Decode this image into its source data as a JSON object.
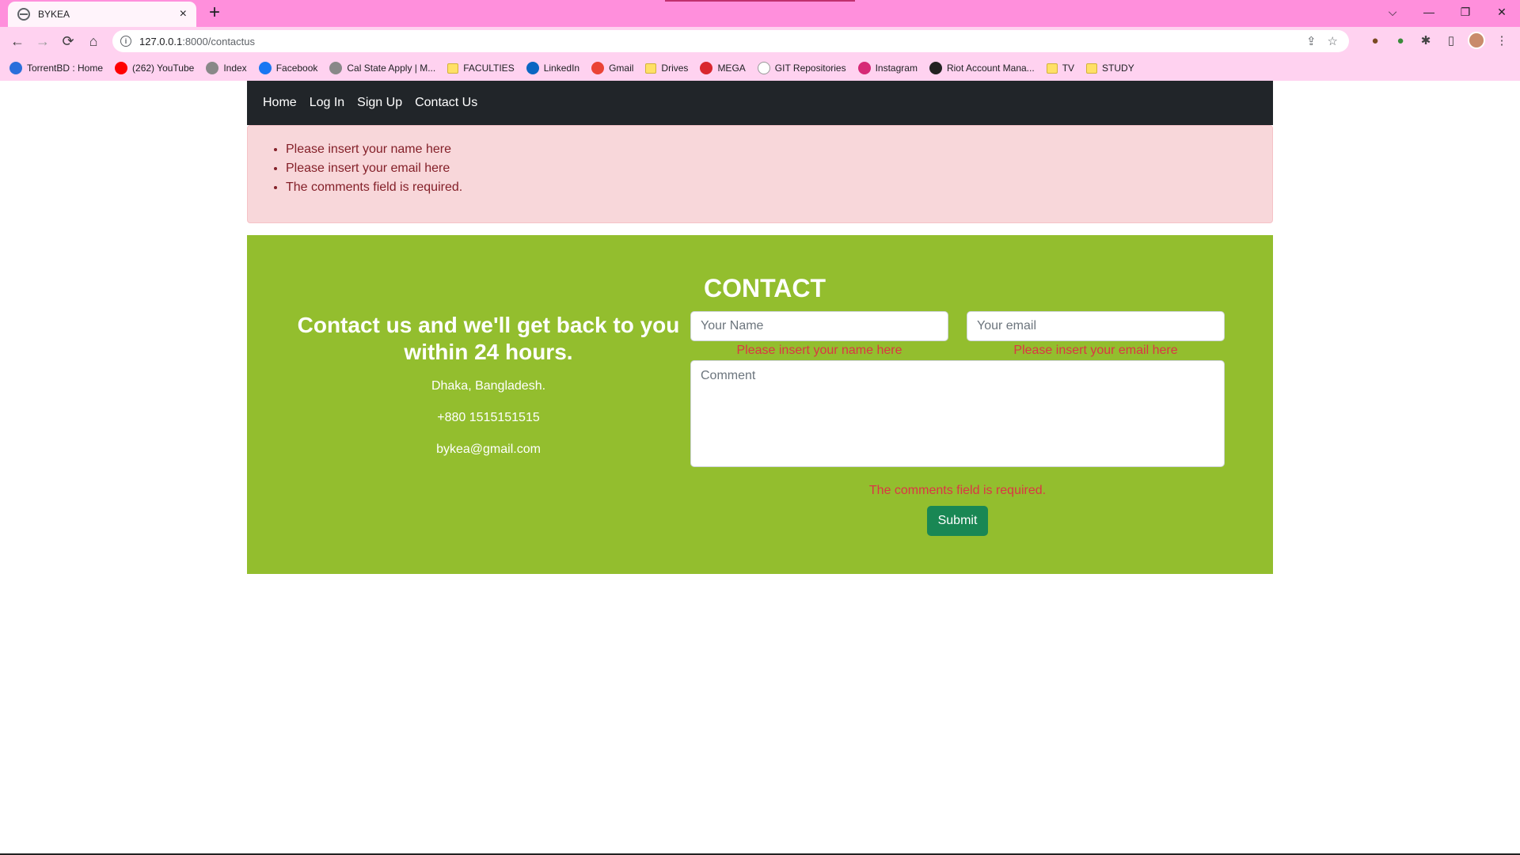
{
  "browser": {
    "tab_title": "BYKEA",
    "tab_close": "×",
    "new_tab": "+",
    "url_host": "127.0.0.1",
    "url_path": ":8000/contactus",
    "window_controls": [
      "⌵",
      "—",
      "❐",
      "✕"
    ],
    "nav_icons": [
      "←",
      "→",
      "⟳",
      "⌂"
    ],
    "omni_icons": [
      "⇪",
      "☆"
    ],
    "bookmarks": [
      {
        "label": "TorrentBD : Home",
        "icon": "torrentbd-icon",
        "color": "#2a6fdb"
      },
      {
        "label": "(262) YouTube",
        "icon": "youtube-icon",
        "color": "#ff0000"
      },
      {
        "label": "Index",
        "icon": "globe-icon",
        "color": "#888888"
      },
      {
        "label": "Facebook",
        "icon": "facebook-icon",
        "color": "#1877f2"
      },
      {
        "label": "Cal State Apply | M...",
        "icon": "globe-icon",
        "color": "#888888"
      },
      {
        "label": "FACULTIES",
        "icon": "folder-icon",
        "color": "#ffe066"
      },
      {
        "label": "LinkedIn",
        "icon": "linkedin-icon",
        "color": "#0a66c2"
      },
      {
        "label": "Gmail",
        "icon": "gmail-icon",
        "color": "#ea4335"
      },
      {
        "label": "Drives",
        "icon": "folder-icon",
        "color": "#ffe066"
      },
      {
        "label": "MEGA",
        "icon": "mega-icon",
        "color": "#d9272e"
      },
      {
        "label": "GIT Repositories",
        "icon": "github-icon",
        "color": "#ffffff"
      },
      {
        "label": "Instagram",
        "icon": "instagram-icon",
        "color": "#d62976"
      },
      {
        "label": "Riot Account Mana...",
        "icon": "riot-icon",
        "color": "#222222"
      },
      {
        "label": "TV",
        "icon": "folder-icon",
        "color": "#ffe066"
      },
      {
        "label": "STUDY",
        "icon": "folder-icon",
        "color": "#ffe066"
      }
    ]
  },
  "nav": {
    "links": [
      "Home",
      "Log In",
      "Sign Up",
      "Contact Us"
    ]
  },
  "alert": {
    "errors": [
      "Please insert your name here",
      "Please insert your email here",
      "The comments field is required."
    ]
  },
  "contact": {
    "title": "CONTACT",
    "heading": "Contact us and we'll get back to you within 24 hours.",
    "address": "Dhaka, Bangladesh.",
    "phone": "+880 1515151515",
    "email": "bykea@gmail.com",
    "name_placeholder": "Your Name",
    "email_placeholder": "Your email",
    "comment_placeholder": "Comment",
    "name_error": "Please insert your name here",
    "email_error": "Please insert your email here",
    "comment_error": "The comments field is required.",
    "submit_label": "Submit"
  },
  "colors": {
    "accent_green": "#93be2e",
    "navbar": "#212529",
    "error": "#dc3545",
    "submit": "#198754"
  }
}
